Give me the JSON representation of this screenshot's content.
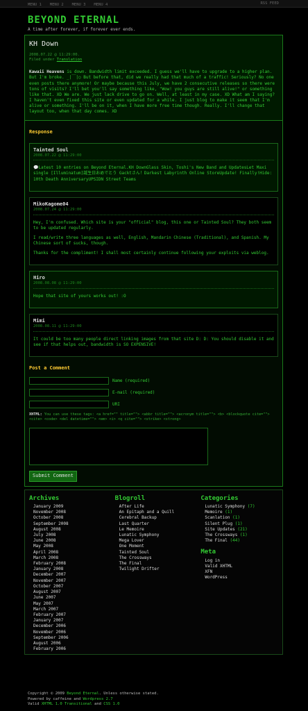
{
  "topnav": {
    "menus": [
      "MENU 1",
      "MENU 2",
      "MENU 3",
      "MENU 4"
    ],
    "rss": "RSS FEED"
  },
  "header": {
    "title": "BEYOND ETERNAL",
    "tagline": "A time after forever, if forever ever ends."
  },
  "post": {
    "title": "KH Down",
    "date": "2008.07.22 @ 11:29:00.",
    "filed_prefix": "Filed under",
    "category": "Translation",
    "author": "Kawaii Heavens",
    "body": " is down. Bandwidth limit exceeded. I guess we'll have to upgrade to a higher plan. But I'm broke. _|￣|○ But before that, did we really had that much of a traffic! Seriously? No one even posts there anymore! Or maybe because this July, we have 2 consecutive releases so there were tons of visits? I'll bet you'll say something like, \"Wow! you guys are still alive!\" or something like that. XD We are. We just lack drive to go on. Well, at least in my case. XD What am I saying? I haven't even fixed this site or even updated for a while. I just blog to make it seem that I'm alive or something. I'll be on it, when I have more free time though. Really. I'll change that layout too, when that day comes. XD"
  },
  "response_heading": "Response",
  "comments": [
    {
      "author": "Tainted Soul",
      "date": "2008.07.22 @ 11:29:00",
      "paragraphs": [
        "Latest 10 entries on Beyond Eternal.KH DownGlass Skin, Toshi's New Band and UpdatesLet Maxi single [Illuminatum]誕生日おめでとう Gacktさん！Darkest Labyrinth Online StoreUpdate! Finally!Hide: 10th Death AnniversaryUPSIDN Street Teams"
      ]
    },
    {
      "author": "MikoKagome04",
      "date": "2008.07.24 @ 11:29:00",
      "paragraphs": [
        "Hey, I'm confused. Which site is your \"official\" blog, this one or Tainted Soul? They both seem to be updated regularly.",
        "I read/write three languages as well, English, Mandarin Chinese (Traditional), and Spanish. My Chinese sort of sucks, though.",
        "Thanks for the compliment! I shall most certainly continue following your exploits via weblog."
      ]
    },
    {
      "author": "Hiro",
      "date": "2008.08.08 @ 11:29:00",
      "paragraphs": [
        "Hope that site of yours works out! :O"
      ]
    },
    {
      "author": "Mimi",
      "date": "2008.08.11 @ 11:29:00",
      "paragraphs": [
        "It could be too many people direct linking images from that site D: D: You should disable it and see if that helps out, bandwidth is SO EXPENSIVE!"
      ]
    }
  ],
  "form": {
    "heading": "Post a Comment",
    "name_label": "Name (required)",
    "email_label": "E-mail (required)",
    "uri_label": "URI",
    "xhtml_label": "XHTML:",
    "xhtml_text": " You can use these tags: <a href=\"\" title=\"\"> <abbr title=\"\"> <acronym title=\"\"> <b> <blockquote cite=\"\"> <cite> <code> <del datetime=\"\"> <em> <i> <q cite=\"\"> <strike> <strong>",
    "submit": "Submit Comment"
  },
  "archives": {
    "heading": "Archives",
    "items": [
      "January 2009",
      "November 2008",
      "October 2008",
      "September 2008",
      "August 2008",
      "July 2008",
      "June 2008",
      "May 2008",
      "April 2008",
      "March 2008",
      "February 2008",
      "January 2008",
      "December 2007",
      "November 2007",
      "October 2007",
      "August 2007",
      "June 2007",
      "May 2007",
      "March 2007",
      "February 2007",
      "January 2007",
      "December 2006",
      "November 2006",
      "September 2006",
      "August 2006",
      "February 2006"
    ]
  },
  "blogroll": {
    "heading": "Blogroll",
    "items": [
      "After Life",
      "An Epitaph and a Quill",
      "Cerebral Backup",
      "Last Quarter",
      "Le Memoire",
      "Lunatic Symphony",
      "Mega Lover",
      "One Moment",
      "Tainted Soul",
      "The Crossways",
      "The Final",
      "Twilight Drifter"
    ]
  },
  "categories": {
    "heading": "Categories",
    "items": [
      {
        "name": "Lunatic Symphony",
        "count": "(7)"
      },
      {
        "name": "Memoire",
        "count": "(1)"
      },
      {
        "name": "Scanlation",
        "count": "(1)"
      },
      {
        "name": "Silent Plug",
        "count": "(1)"
      },
      {
        "name": "Site Updates",
        "count": "(21)"
      },
      {
        "name": "The Crossways",
        "count": "(1)"
      },
      {
        "name": "The Final",
        "count": "(44)"
      }
    ]
  },
  "meta": {
    "heading": "Meta",
    "items": [
      "Log in",
      "Valid XHTML",
      "XFN",
      "WordPress"
    ]
  },
  "copyright": {
    "line1_pre": "Copyright © 2009 ",
    "line1_site": "Beyond Eternal",
    "line1_post": ". Unless otherwise stated.",
    "line2_pre": "Powered by caffeine and ",
    "line2_wp": "Wordpress 2.7",
    "line3_pre": "Valid ",
    "line3_xhtml": "XHTML 1.0 Transitional",
    "line3_mid": " and ",
    "line3_css": "CSS 1.0"
  }
}
